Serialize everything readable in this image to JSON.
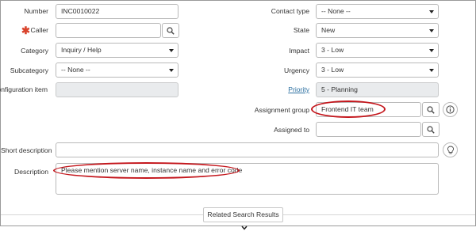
{
  "left": {
    "number": {
      "label": "Number",
      "value": "INC0010022"
    },
    "caller": {
      "label": "Caller",
      "value": ""
    },
    "category": {
      "label": "Category",
      "value": "Inquiry / Help"
    },
    "subcategory": {
      "label": "Subcategory",
      "value": "-- None --"
    },
    "configuration_item": {
      "label": "Configuration item",
      "value": ""
    }
  },
  "right": {
    "contact_type": {
      "label": "Contact type",
      "value": "-- None --"
    },
    "state": {
      "label": "State",
      "value": "New"
    },
    "impact": {
      "label": "Impact",
      "value": "3 - Low"
    },
    "urgency": {
      "label": "Urgency",
      "value": "3 - Low"
    },
    "priority": {
      "label": "Priority",
      "value": "5 - Planning"
    },
    "assignment_group": {
      "label": "Assignment group",
      "value": "Frontend IT team"
    },
    "assigned_to": {
      "label": "Assigned to",
      "value": ""
    }
  },
  "short_description": {
    "label": "Short description",
    "value": ""
  },
  "description": {
    "label": "Description",
    "value": "Please mention server name, instance name and error code"
  },
  "related_search": {
    "label": "Related Search Results"
  },
  "colors": {
    "required": "#d9432b",
    "highlight": "#c4161c",
    "readonly": "#e9ebed",
    "link": "#2b6fa0"
  },
  "icons": {
    "search": "search-icon",
    "info": "info-icon",
    "lightbulb": "lightbulb-icon",
    "dropdown": "chevron-down-icon",
    "required": "required-asterisk-icon"
  }
}
